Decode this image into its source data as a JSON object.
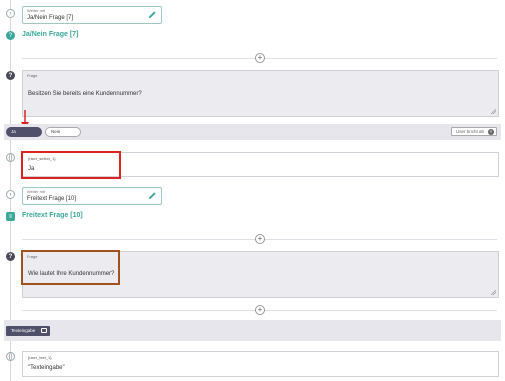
{
  "node1": {
    "label": "Weiter mit",
    "value": "Ja/Nein Frage [7]"
  },
  "section1_title": "Ja/Nein Frage [7]",
  "question1": {
    "label": "Frage",
    "text": "Besitzen Sie bereits eine Kundennummer?"
  },
  "options": {
    "ja": "Ja",
    "nein": "Nein"
  },
  "user_exit": "User bricht ab",
  "answer1": {
    "label": "{user_select_1}",
    "value": "Ja"
  },
  "node2": {
    "label": "Weiter mit",
    "value": "Freitext Frage [10]"
  },
  "section2_title": "Freitext Frage [10]",
  "question2": {
    "label": "Frage",
    "text": "Wie lautet Ihre Kundennummer?"
  },
  "input_button": "Texteingabe",
  "answer2": {
    "label": "{user_text_1}",
    "value": "\"Texteingabe\""
  },
  "colors": {
    "teal": "#3aa79a",
    "dark": "#50506a",
    "red": "#d22222",
    "brown": "#a0521c"
  }
}
